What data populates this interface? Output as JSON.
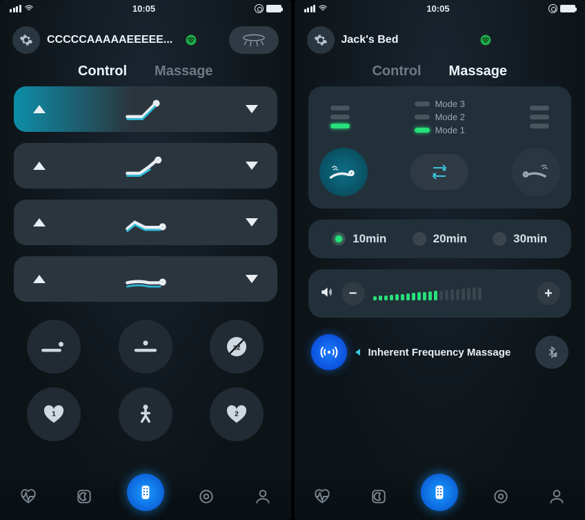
{
  "status": {
    "time": "10:05"
  },
  "left": {
    "device_name": "CCCCCAAAAAEEEEE...",
    "tabs": {
      "control": "Control",
      "massage": "Massage",
      "active": "control"
    },
    "presets": {
      "fav1_num": "1",
      "fav2_num": "2"
    }
  },
  "right": {
    "device_name": "Jack's Bed",
    "tabs": {
      "control": "Control",
      "massage": "Massage",
      "active": "massage"
    },
    "modes": {
      "m3": "Mode 3",
      "m2": "Mode 2",
      "m1": "Mode 1"
    },
    "timers": {
      "t10": "10min",
      "t20": "20min",
      "t30": "30min",
      "selected": "10"
    },
    "volume": {
      "level": 12,
      "max": 20
    },
    "freq_label": "Inherent Frequency Massage"
  }
}
